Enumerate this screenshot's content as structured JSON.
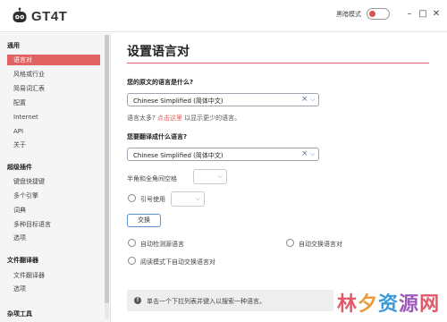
{
  "app": {
    "name": "GT4T"
  },
  "header": {
    "dark_mode_label": "黑暗模式",
    "minimize": "–",
    "maximize": "□",
    "close": "✕"
  },
  "sidebar": {
    "sections": [
      {
        "title": "通用",
        "items": [
          "语言对",
          "风格或行业",
          "简易词汇表",
          "配置",
          "Internet",
          "API",
          "关于"
        ]
      },
      {
        "title": "超级插件",
        "items": [
          "键盘快捷键",
          "多个引擎",
          "词典",
          "多种目标语言",
          "选项"
        ]
      },
      {
        "title": "文件翻译器",
        "items": [
          "文件翻译器",
          "选项"
        ]
      },
      {
        "title": "杂项工具",
        "items": []
      }
    ],
    "active_item": "语言对"
  },
  "main": {
    "title": "设置语言对",
    "source_question": "您的原文的语言是什么?",
    "source_value": "Chinese Simplified (简体中文)",
    "hint_prefix": "语言太多?",
    "hint_link": "点击这里",
    "hint_suffix": "以显示更少的语言。",
    "target_question": "您要翻译成什么语言?",
    "target_value": "Chinese Simplified (简体中文)",
    "halfwidth_label": "半角和全角间空格",
    "quote_label": "引号使用",
    "swap_button": "交换",
    "options": {
      "auto_detect": "自动检测源语言",
      "auto_swap": "自动交换语言对",
      "reading_mode": "阅读模式下自动交换语言对"
    },
    "info_text": "单击一个下拉列表并键入以搜索一种语言。"
  },
  "watermark": {
    "chars": [
      "林",
      "夕",
      "资",
      "源",
      "网"
    ]
  },
  "colors": {
    "accent": "#e06262",
    "select_icon": "#5577aa",
    "button_border": "#5a8fd0"
  },
  "icons": {
    "logo": "robot-logo-icon",
    "info": "info-icon",
    "clear": "clear-icon",
    "dropdown": "chevron-down-icon"
  }
}
